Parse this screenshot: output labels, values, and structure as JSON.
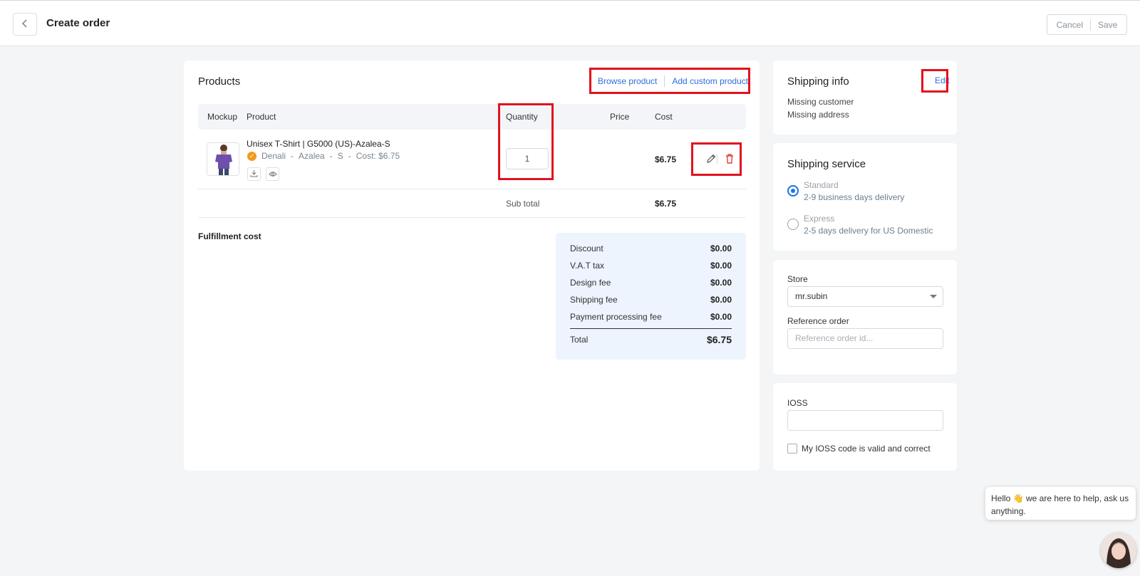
{
  "header": {
    "title": "Create order",
    "cancel_label": "Cancel",
    "save_label": "Save"
  },
  "products": {
    "title": "Products",
    "browse_label": "Browse product",
    "add_custom_label": "Add custom product",
    "columns": {
      "mockup": "Mockup",
      "product": "Product",
      "quantity": "Quantity",
      "price": "Price",
      "cost": "Cost"
    },
    "items": [
      {
        "name": "Unisex T-Shirt | G5000 (US)-Azalea-S",
        "supplier": "Denali",
        "color": "Azalea",
        "size": "S",
        "unit_cost": "Cost: $6.75",
        "quantity": "1",
        "price": "",
        "cost": "$6.75"
      }
    ],
    "subtotal_label": "Sub total",
    "subtotal_value": "$6.75",
    "separator": "-"
  },
  "fulfillment": {
    "title": "Fulfillment cost",
    "rows": [
      {
        "label": "Discount",
        "value": "$0.00"
      },
      {
        "label": "V.A.T tax",
        "value": "$0.00"
      },
      {
        "label": "Design fee",
        "value": "$0.00"
      },
      {
        "label": "Shipping fee",
        "value": "$0.00"
      },
      {
        "label": "Payment processing fee",
        "value": "$0.00"
      }
    ],
    "total_label": "Total",
    "total_value": "$6.75"
  },
  "shipping_info": {
    "title": "Shipping info",
    "edit_label": "Edit",
    "customer": "Missing customer",
    "address": "Missing address"
  },
  "shipping_service": {
    "title": "Shipping service",
    "options": [
      {
        "name": "Standard",
        "desc": "2-9 business days delivery",
        "selected": true
      },
      {
        "name": "Express",
        "desc": "2-5 days delivery for US Domestic",
        "selected": false
      }
    ]
  },
  "store": {
    "label": "Store",
    "value": "mr.subin",
    "reference_label": "Reference order",
    "reference_placeholder": "Reference order id..."
  },
  "ioss": {
    "label": "IOSS",
    "value": "",
    "checkbox_label": "My IOSS code is valid and correct"
  },
  "chat": {
    "message_start": "Hello",
    "emoji": "👋",
    "message_end": "we are here to help, ask us anything."
  },
  "colors": {
    "accent": "#2f6fda",
    "radio": "#1a73e8",
    "highlight": "#e2121d",
    "summary_bg": "#edf4fd",
    "badge": "#f39a1f"
  }
}
